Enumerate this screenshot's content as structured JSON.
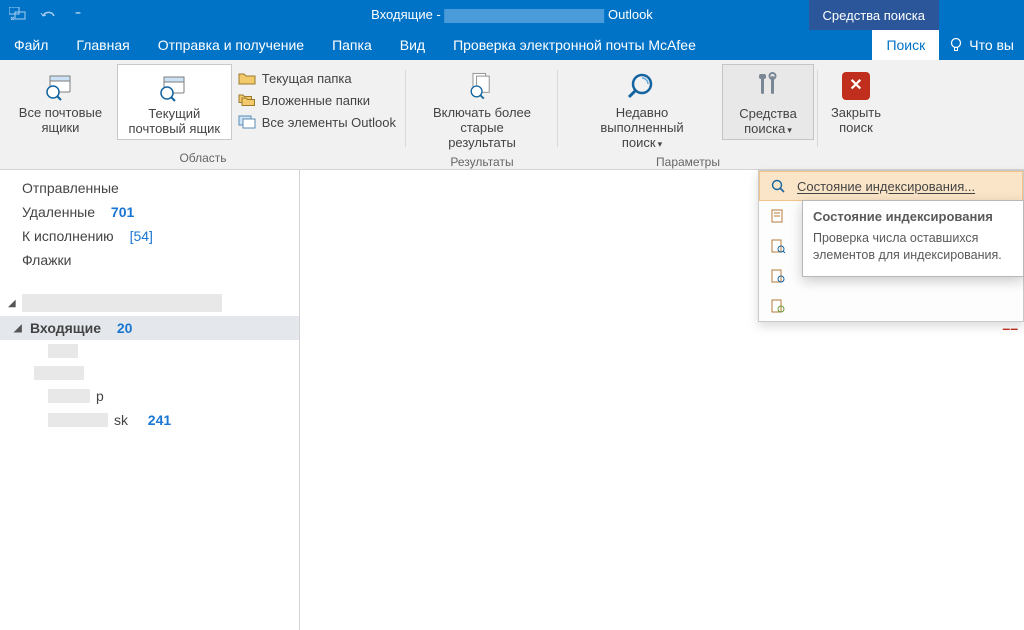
{
  "titlebar": {
    "title_prefix": "Входящие - ",
    "title_suffix": " Outlook",
    "context_tab": "Средства поиска"
  },
  "tabs": {
    "file": "Файл",
    "home": "Главная",
    "sendrecv": "Отправка и получение",
    "folder": "Папка",
    "view": "Вид",
    "mcafee": "Проверка электронной почты McAfee",
    "search": "Поиск",
    "tell_me": "Что вы"
  },
  "ribbon": {
    "scope": {
      "label": "Область",
      "all_mailboxes": "Все почтовые ящики",
      "current_mailbox": "Текущий почтовый ящик",
      "current_folder": "Текущая папка",
      "subfolders": "Вложенные папки",
      "all_outlook": "Все элементы Outlook"
    },
    "results": {
      "label": "Результаты",
      "include_older": "Включать более старые результаты"
    },
    "options": {
      "label": "Параметры",
      "recent": "Недавно выполненный поиск",
      "tools": "Средства поиска"
    },
    "close": {
      "label": "Закрыть поиск"
    }
  },
  "menu": {
    "item1": "Состояние индексирования..."
  },
  "tooltip": {
    "title": "Состояние индексирования",
    "body": "Проверка числа оставшихся элементов для индексирования."
  },
  "folders": {
    "sent": "Отправленные",
    "deleted": "Удаленные",
    "deleted_count": "701",
    "followup": "К исполнению",
    "followup_count": "[54]",
    "flags": "Флажки",
    "inbox": "Входящие",
    "inbox_count": "20",
    "sub_p": "p",
    "sub_sk": "sk",
    "sub_sk_count": "241"
  }
}
